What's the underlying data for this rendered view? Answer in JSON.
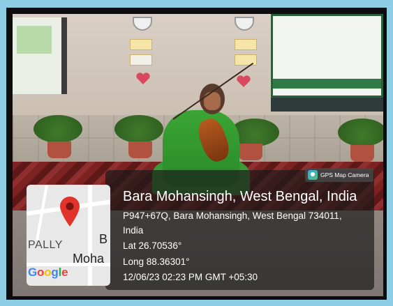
{
  "badge": {
    "label": "GPS Map Camera",
    "icon": "gps-map-camera-icon"
  },
  "location": {
    "title": "Bara Mohansingh, West Bengal, India",
    "address_line1": "P947+67Q, Bara Mohansingh, West Bengal 734011,",
    "address_line2": "India",
    "lat": "Lat 26.70536°",
    "long": "Long 88.36301°",
    "datetime": "12/06/23 02:23 PM GMT +05:30"
  },
  "map": {
    "label_pally": "PALLY",
    "label_b": "B",
    "label_moha": "Moha",
    "logo": "Google",
    "pin_icon": "map-pin-icon"
  },
  "colors": {
    "frame": "#8ecfe6",
    "pin": "#e0342a",
    "overlay": "#191919"
  }
}
